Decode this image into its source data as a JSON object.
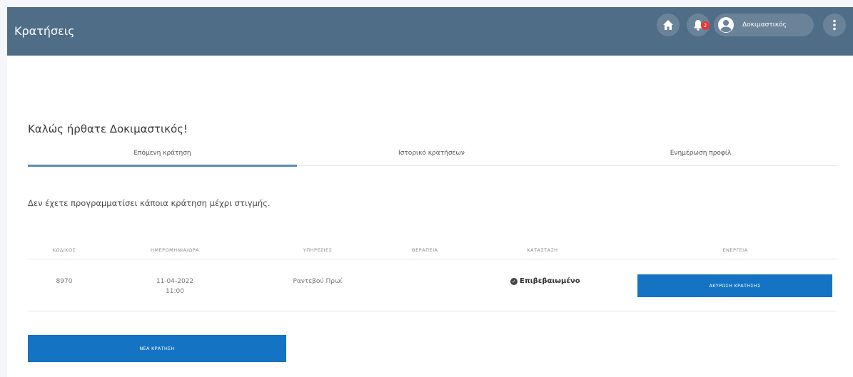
{
  "header": {
    "title": "Κρατήσεις",
    "notification_count": "2",
    "user_name": "Δοκιμαστικός"
  },
  "welcome": "Καλώς ήρθατε Δοκιμαστικός!",
  "tabs": [
    {
      "label": "Επόμενη κράτηση"
    },
    {
      "label": "Ιστορικό κρατήσεων"
    },
    {
      "label": "Ενημέρωση προφίλ"
    }
  ],
  "notice": "Δεν έχετε προγραμματίσει κάποια κράτηση μέχρι στιγμής.",
  "table": {
    "headers": [
      "ΚΩΔΙΚΟΣ",
      "ΗΜΕΡΟΜΗΝΙΑ/ΩΡΑ",
      "ΥΠΗΡΕΣΙΕΣ",
      "ΘΕΡΑΠΕΙΑ",
      "ΚΑΤΑΣΤΑΣΗ",
      "ΕΝΕΡΓΕΙΑ"
    ],
    "rows": [
      {
        "code": "8970",
        "date": "11-04-2022",
        "time": "11:00",
        "service": "Ραντεβού Πρωί",
        "therapy": "",
        "status": "Επιβεβαιωμένο",
        "action": "ΑΚΥΡΩΣΗ ΚΡΑΤΗΣΗΣ"
      }
    ]
  },
  "new_booking_label": "ΝΕΑ ΚΡΑΤΗΣΗ",
  "colors": {
    "header": "#4f6d87",
    "primary_button": "#1473c2",
    "tab_active": "#5b8db3",
    "badge": "#e53935"
  }
}
